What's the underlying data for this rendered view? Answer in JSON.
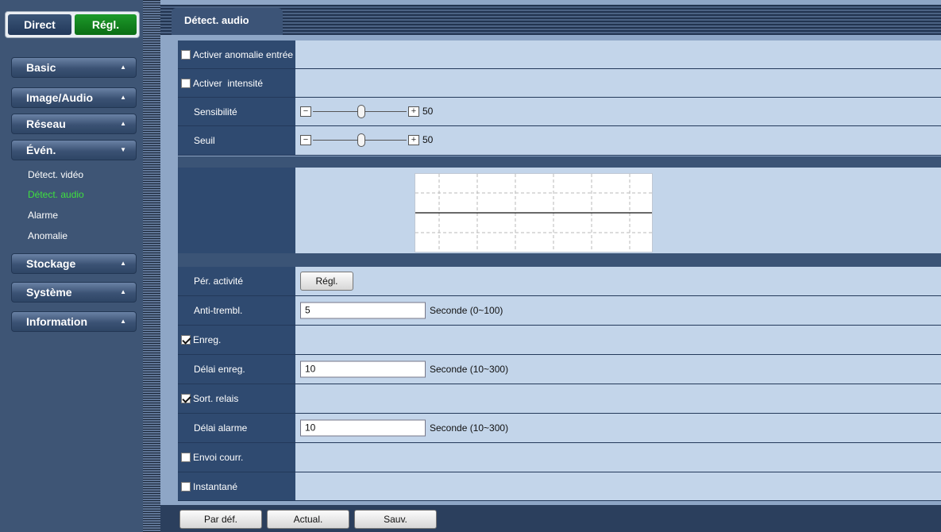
{
  "mode": {
    "direct": "Direct",
    "setup": "Régl."
  },
  "menu": {
    "basic": "Basic",
    "image_audio": "Image/Audio",
    "network": "Réseau",
    "event": "Évén.",
    "event_sub": [
      "Détect. vidéo",
      "Détect. audio",
      "Alarme",
      "Anomalie"
    ],
    "storage": "Stockage",
    "system": "Système",
    "information": "Information"
  },
  "tab": {
    "label": "Détect. audio"
  },
  "form": {
    "anomaly_input": {
      "label": "Activer anomalie entrée",
      "checked": false
    },
    "intensity": {
      "label": "Activer  intensité",
      "checked": false
    },
    "sensitivity": {
      "label": "Sensibilité",
      "value": "50",
      "minus": "−",
      "plus": "+"
    },
    "threshold": {
      "label": "Seuil",
      "value": "50",
      "minus": "−",
      "plus": "+"
    },
    "activity_period": {
      "label": "Pér. activité",
      "button": "Régl."
    },
    "anti_bounce": {
      "label": "Anti-trembl.",
      "value": "5",
      "unit": "Seconde (0~100)"
    },
    "record": {
      "label": "Enreg.",
      "checked": true
    },
    "record_delay": {
      "label": "Délai enreg.",
      "value": "10",
      "unit": "Seconde (10~300)"
    },
    "relay_out": {
      "label": "Sort. relais",
      "checked": true
    },
    "alarm_delay": {
      "label": "Délai alarme",
      "value": "10",
      "unit": "Seconde (10~300)"
    },
    "send_mail": {
      "label": "Envoi courr.",
      "checked": false
    },
    "snapshot": {
      "label": "Instantané",
      "checked": false
    }
  },
  "footer": {
    "default": "Par déf.",
    "refresh": "Actual.",
    "save": "Sauv."
  },
  "colors": {
    "active_green": "#3fe03f",
    "setup_green": "#0b6d14",
    "label_bg": "#2f4a70",
    "value_bg": "#c3d5ea"
  }
}
